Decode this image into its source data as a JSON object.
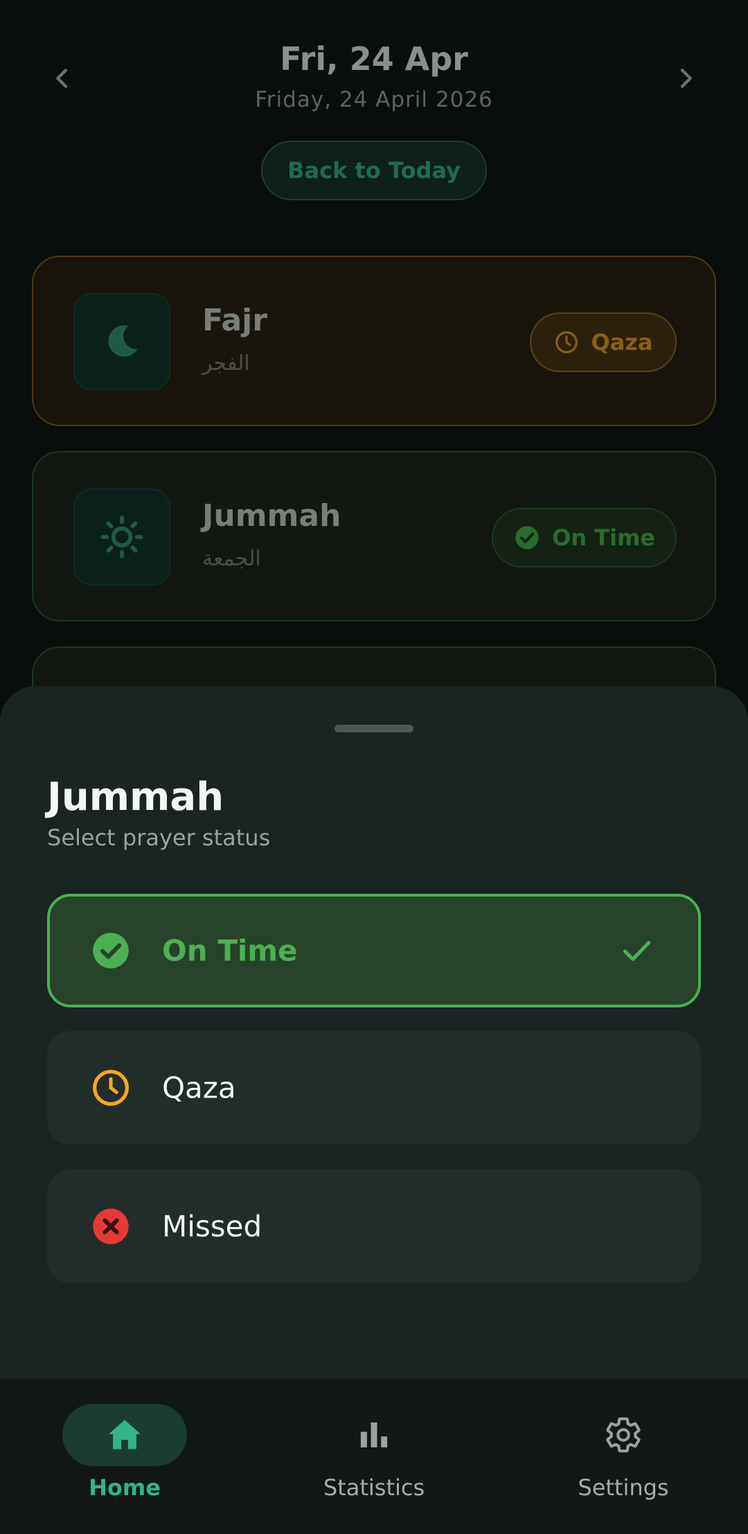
{
  "header": {
    "title": "Fri, 24 Apr",
    "subtitle": "Friday, 24 April 2026",
    "back_to_today": "Back to Today",
    "prev_icon": "chevron-left-icon",
    "next_icon": "chevron-right-icon"
  },
  "prayers": [
    {
      "name": "Fajr",
      "arabic": "الفجر",
      "status": "Qaza",
      "icon": "moon-icon"
    },
    {
      "name": "Jummah",
      "arabic": "الجمعة",
      "status": "On Time",
      "icon": "sun-icon"
    }
  ],
  "sheet": {
    "title": "Jummah",
    "subtitle": "Select prayer status",
    "options": [
      {
        "label": "On Time",
        "icon": "check-circle-icon",
        "selected": true
      },
      {
        "label": "Qaza",
        "icon": "clock-icon",
        "selected": false
      },
      {
        "label": "Missed",
        "icon": "x-circle-icon",
        "selected": false
      }
    ]
  },
  "nav": {
    "items": [
      {
        "label": "Home",
        "icon": "home-icon",
        "active": true
      },
      {
        "label": "Statistics",
        "icon": "bar-chart-icon",
        "active": false
      },
      {
        "label": "Settings",
        "icon": "gear-icon",
        "active": false
      }
    ]
  },
  "colors": {
    "accent": "#34b38a",
    "on_time": "#4cb052",
    "qaza": "#f5a623",
    "missed": "#e53935",
    "sheet_bg": "#1a2422"
  }
}
